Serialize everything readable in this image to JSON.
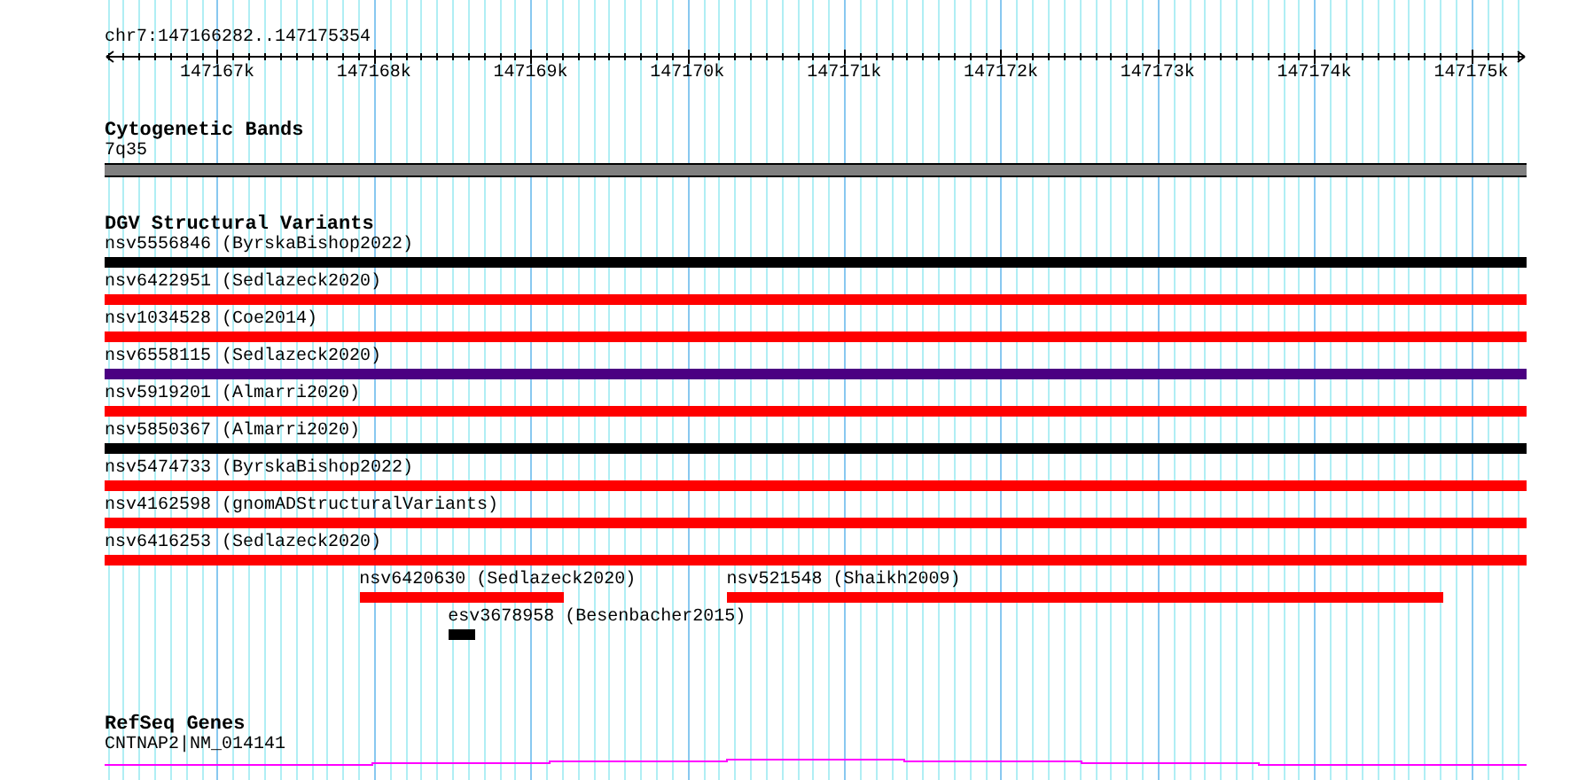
{
  "ruler": {
    "location": "chr7:147166282..147175354",
    "ticks": [
      "147167k",
      "147168k",
      "147169k",
      "147170k",
      "147171k",
      "147172k",
      "147173k",
      "147174k",
      "147175k"
    ]
  },
  "tracks": [
    {
      "kind": "bands",
      "title": "Cytogenetic Bands",
      "rows": [
        [
          {
            "label": "7q35",
            "color": "#808080"
          }
        ]
      ]
    },
    {
      "kind": "variants",
      "title": "DGV Structural Variants",
      "rows": [
        [
          {
            "label": "nsv5556846 (ByrskaBishop2022)",
            "color": "#000000"
          }
        ],
        [
          {
            "label": "nsv6422951 (Sedlazeck2020)",
            "color": "#ff0000"
          }
        ],
        [
          {
            "label": "nsv1034528 (Coe2014)",
            "color": "#ff0000"
          }
        ],
        [
          {
            "label": "nsv6558115 (Sedlazeck2020)",
            "color": "#4b0082"
          }
        ],
        [
          {
            "label": "nsv5919201 (Almarri2020)",
            "color": "#ff0000"
          }
        ],
        [
          {
            "label": "nsv5850367 (Almarri2020)",
            "color": "#000000"
          }
        ],
        [
          {
            "label": "nsv5474733 (ByrskaBishop2022)",
            "color": "#ff0000"
          }
        ],
        [
          {
            "label": "nsv4162598 (gnomADStructuralVariants)",
            "color": "#ff0000"
          }
        ],
        [
          {
            "label": "nsv6416253 (Sedlazeck2020)",
            "color": "#ff0000"
          }
        ],
        [
          {
            "label": "nsv6420630 (Sedlazeck2020)",
            "color": "#ff0000"
          },
          {
            "label": "nsv521548 (Shaikh2009)",
            "color": "#ff0000"
          }
        ],
        [
          {
            "label": "esv3678958 (Besenbacher2015)",
            "color": "#000000"
          }
        ]
      ]
    },
    {
      "kind": "genes",
      "title": "RefSeq Genes",
      "rows": [
        [
          {
            "label": "CNTNAP2|NM_014141",
            "color": "#ff00ff"
          }
        ]
      ]
    }
  ]
}
